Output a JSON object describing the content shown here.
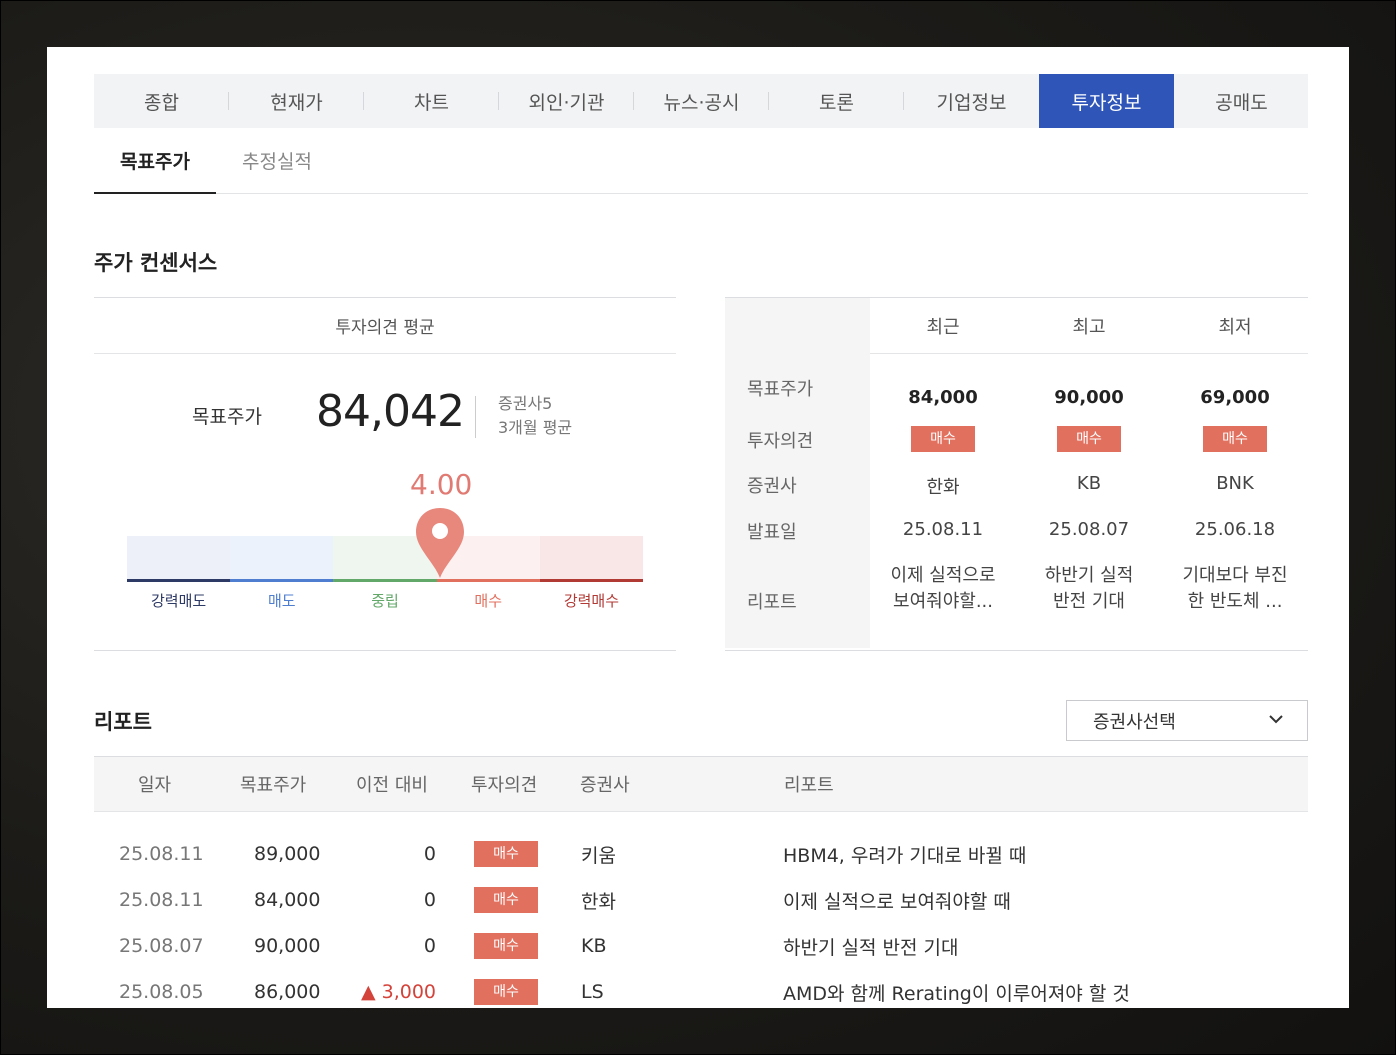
{
  "main_tabs": [
    "종합",
    "현재가",
    "차트",
    "외인·기관",
    "뉴스·공시",
    "토론",
    "기업정보",
    "투자정보",
    "공매도"
  ],
  "active_main_tab": "투자정보",
  "sub_tabs": [
    "목표주가",
    "추정실적"
  ],
  "consensus": {
    "title": "주가 컨센서스",
    "left_header": "투자의견 평균",
    "target_label": "목표주가",
    "target_value": "84,042",
    "broker_count": "증권사5",
    "period": "3개월 평균",
    "score": "4.00",
    "score_value": 4.0,
    "scale_labels": [
      "강력매도",
      "매도",
      "중립",
      "매수",
      "강력매수"
    ],
    "scale_colors": [
      "#2e3a66",
      "#4f7ed0",
      "#62a868",
      "#e2705f",
      "#b23a35"
    ]
  },
  "summary_table": {
    "columns": [
      "최근",
      "최고",
      "최저"
    ],
    "row_labels": [
      "목표주가",
      "투자의견",
      "증권사",
      "발표일",
      "리포트"
    ],
    "cells": [
      {
        "price": "84,000",
        "opinion": "매수",
        "broker": "한화",
        "date": "25.08.11",
        "report_l1": "이제 실적으로",
        "report_l2": "보여줘야할..."
      },
      {
        "price": "90,000",
        "opinion": "매수",
        "broker": "KB",
        "date": "25.08.07",
        "report_l1": "하반기 실적",
        "report_l2": "반전 기대"
      },
      {
        "price": "69,000",
        "opinion": "매수",
        "broker": "BNK",
        "date": "25.06.18",
        "report_l1": "기대보다 부진",
        "report_l2": "한 반도체 ..."
      }
    ]
  },
  "reports": {
    "title": "리포트",
    "select_placeholder": "증권사선택",
    "headers": [
      "일자",
      "목표주가",
      "이전 대비",
      "투자의견",
      "증권사",
      "리포트"
    ],
    "rows": [
      {
        "date": "25.08.11",
        "price": "89,000",
        "change": "0",
        "up": false,
        "opinion": "매수",
        "broker": "키움",
        "title": "HBM4, 우려가 기대로 바뀔 때"
      },
      {
        "date": "25.08.11",
        "price": "84,000",
        "change": "0",
        "up": false,
        "opinion": "매수",
        "broker": "한화",
        "title": "이제 실적으로 보여줘야할 때"
      },
      {
        "date": "25.08.07",
        "price": "90,000",
        "change": "0",
        "up": false,
        "opinion": "매수",
        "broker": "KB",
        "title": "하반기 실적 반전 기대"
      },
      {
        "date": "25.08.05",
        "price": "86,000",
        "change": "▲ 3,000",
        "up": true,
        "opinion": "매수",
        "broker": "LS",
        "title": "AMD와 함께 Rerating이 이루어져야 할 것"
      }
    ]
  }
}
